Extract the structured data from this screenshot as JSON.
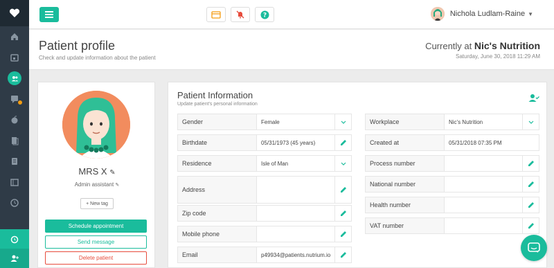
{
  "colors": {
    "accent": "#1abc9c",
    "sidebar": "#2f3b47",
    "danger": "#e74c3c",
    "warning": "#f39c12"
  },
  "sidebar": {
    "logo_icon": "heart-logo-icon",
    "items": [
      {
        "icon": "home-icon"
      },
      {
        "icon": "calendar-icon"
      },
      {
        "icon": "patients-icon",
        "active": true
      },
      {
        "icon": "messages-icon",
        "badge": true
      },
      {
        "icon": "apple-icon"
      },
      {
        "icon": "documents-icon"
      },
      {
        "icon": "notes-icon"
      },
      {
        "icon": "library-icon"
      },
      {
        "icon": "history-icon"
      }
    ],
    "bottom": [
      {
        "icon": "alarm-icon"
      },
      {
        "icon": "add-user-icon"
      }
    ]
  },
  "topbar": {
    "menu_icon": "hamburger-icon",
    "icons": [
      "card-icon",
      "bell-off-icon",
      "help-icon"
    ],
    "user_name": "Nichola Ludlam-Raine"
  },
  "header": {
    "title": "Patient profile",
    "subtitle": "Check and update information about the patient",
    "currently_at_label": "Currently at",
    "clinic": "Nic's Nutrition",
    "datetime": "Saturday, June 30, 2018 11:29 AM"
  },
  "profile": {
    "name": "MRS X",
    "role": "Admin assistant",
    "new_tag": "+ New tag",
    "schedule": "Schedule appointment",
    "message": "Send message",
    "delete": "Delete patient"
  },
  "info": {
    "title": "Patient Information",
    "subtitle": "Update patient's personal information",
    "left": [
      {
        "label": "Gender",
        "value": "Female",
        "action": "dropdown"
      },
      {
        "label": "Birthdate",
        "value": "05/31/1973 (45 years)",
        "action": "edit"
      },
      {
        "label": "Residence",
        "value": "Isle of Man",
        "action": "dropdown"
      },
      {
        "label": "Address",
        "value": "",
        "action": "edit"
      },
      {
        "label": "Zip code",
        "value": "",
        "action": "edit"
      },
      {
        "label": "Mobile phone",
        "value": "",
        "action": "edit"
      },
      {
        "label": "Email",
        "value": "p49934@patients.nutrium.io",
        "action": "edit"
      }
    ],
    "right": [
      {
        "label": "Workplace",
        "value": "Nic's Nutrition",
        "action": "dropdown"
      },
      {
        "label": "Created at",
        "value": "05/31/2018 07:35 PM",
        "action": "none"
      },
      {
        "label": "Process number",
        "value": "",
        "action": "edit"
      },
      {
        "label": "National number",
        "value": "",
        "action": "edit"
      },
      {
        "label": "Health number",
        "value": "",
        "action": "edit"
      },
      {
        "label": "VAT number",
        "value": "",
        "action": "edit"
      }
    ]
  },
  "chat_icon": "chat-icon"
}
